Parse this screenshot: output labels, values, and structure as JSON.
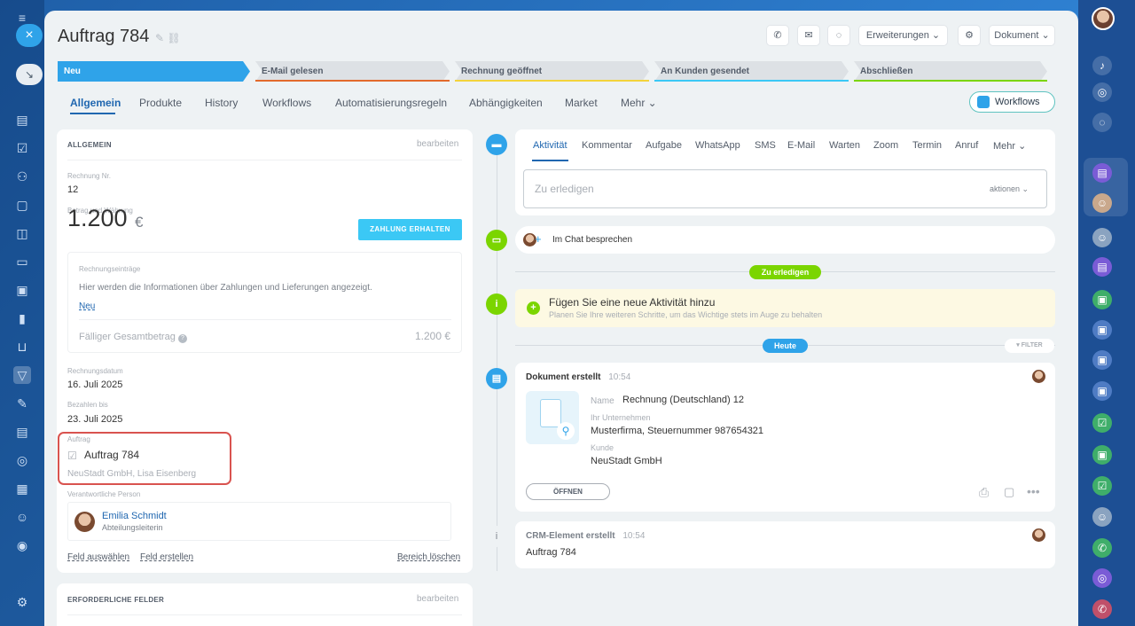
{
  "window": {
    "title": "Auftrag 784"
  },
  "header": {
    "buttons": {
      "extensions": "Erweiterungen",
      "document": "Dokument"
    }
  },
  "pipeline": [
    {
      "label": "Neu",
      "color": "#2fa3e9"
    },
    {
      "label": "E-Mail gelesen",
      "color": "#e26a2c"
    },
    {
      "label": "Rechnung geöffnet",
      "color": "#f3d33c"
    },
    {
      "label": "An Kunden gesendet",
      "color": "#3bc8f5"
    },
    {
      "label": "Abschließen",
      "color": "#7bd500"
    }
  ],
  "tabs": [
    "Allgemein",
    "Produkte",
    "History",
    "Workflows",
    "Automatisierungsregeln",
    "Abhängigkeiten",
    "Market",
    "Mehr"
  ],
  "workflows_button": "Workflows",
  "general": {
    "title": "ALLGEMEIN",
    "edit": "bearbeiten",
    "invoice_no_label": "Rechnung Nr.",
    "invoice_no": "12",
    "amount_label": "Betrag und Währung",
    "amount": "1.200",
    "currency": "€",
    "pay_button": "ZAHLUNG ERHALTEN",
    "entries_label": "Rechnungseinträge",
    "entries_info": "Hier werden die Informationen über Zahlungen und Lieferungen angezeigt.",
    "entries_new": "Neu",
    "due_total_label": "Fälliger Gesamtbetrag",
    "due_total": "1.200 €",
    "invoice_date_label": "Rechnungsdatum",
    "invoice_date": "16. Juli 2025",
    "pay_until_label": "Bezahlen bis",
    "pay_until": "23. Juli 2025",
    "order_label": "Auftrag",
    "order_value": "Auftrag 784",
    "order_client": "NeuStadt GmbH, Lisa Eisenberg",
    "responsible_label": "Verantwortliche Person",
    "responsible_name": "Emilia Schmidt",
    "responsible_role": "Abteilungsleiterin",
    "select_field": "Feld auswählen",
    "create_field": "Feld erstellen",
    "delete_section": "Bereich löschen"
  },
  "required": {
    "title": "ERFORDERLICHE FELDER",
    "edit": "bearbeiten"
  },
  "activity": {
    "tabs": [
      "Aktivität",
      "Kommentar",
      "Aufgabe",
      "WhatsApp",
      "SMS",
      "E-Mail",
      "Warten",
      "Zoom",
      "Termin",
      "Anruf",
      "Mehr"
    ],
    "todo_placeholder": "Zu erledigen",
    "actions": "aktionen",
    "chat": "Im Chat besprechen",
    "todo_pill": "Zu erledigen",
    "new_activity_title": "Fügen Sie eine neue Aktivität hinzu",
    "new_activity_sub": "Planen Sie Ihre weiteren Schritte, um das Wichtige stets im Auge zu behalten",
    "today_pill": "Heute",
    "filter": "FILTER"
  },
  "doc_event": {
    "title": "Dokument erstellt",
    "time": "10:54",
    "name_label": "Name",
    "name": "Rechnung (Deutschland) 12",
    "company_label": "Ihr Unternehmen",
    "company": "Musterfirma, Steuernummer 987654321",
    "client_label": "Kunde",
    "client": "NeuStadt GmbH",
    "open": "ÖFFNEN"
  },
  "crm_event": {
    "title": "CRM-Element erstellt",
    "time": "10:54",
    "value": "Auftrag 784"
  },
  "colors": {
    "accent": "#2fa3e9",
    "green": "#7bd500",
    "highlight": "#d9534f"
  }
}
